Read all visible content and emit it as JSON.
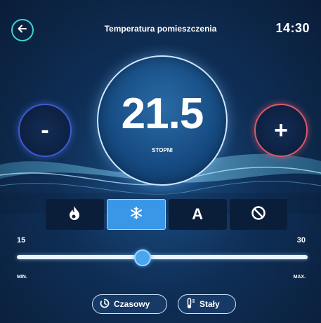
{
  "header": {
    "title": "Temperatura pomieszczenia",
    "time": "14:30"
  },
  "thermostat": {
    "temperature": "21.5",
    "unit_label": "STOPNI",
    "minus_label": "-",
    "plus_label": "+"
  },
  "modes": [
    {
      "id": "heat",
      "icon": "flame-icon",
      "active": false
    },
    {
      "id": "cool",
      "icon": "snowflake-icon",
      "active": true
    },
    {
      "id": "auto",
      "icon": "letter-a-icon",
      "label": "A",
      "active": false
    },
    {
      "id": "off",
      "icon": "prohibited-icon",
      "active": false
    }
  ],
  "slider": {
    "min": "15",
    "max": "30",
    "value": 21.5,
    "min_label": "MIN.",
    "max_label": "MAX."
  },
  "buttons": {
    "timer_label": "Czasowy",
    "fixed_label": "Stały"
  },
  "colors": {
    "accent": "#3a97e8",
    "minus_ring": "#3d5bd0",
    "plus_ring": "#d85a6a",
    "back_ring": "#3fd1cf"
  }
}
